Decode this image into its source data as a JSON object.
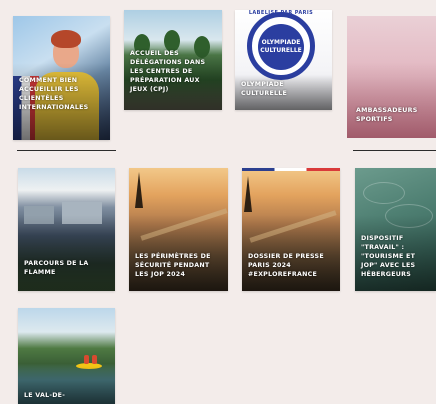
{
  "cards": [
    {
      "label": "COMMENT BIEN ACCUEILLIR LES CLIENTÈLES INTERNATIONALES"
    },
    {
      "label": "ACCUEIL DES DÉLÉGATIONS DANS LES CENTRES DE PRÉPARATION AUX JEUX (CPJ)"
    },
    {
      "label": "OLYMPIADE CULTURELLE",
      "logo_line1": "OLYMPIADE",
      "logo_line2": "CULTURELLE",
      "logo_ring": "LABELISÉ PAR PARIS 2024"
    },
    {
      "label": "AMBASSADEURS SPORTIFS"
    },
    {
      "label": "PARCOURS DE LA FLAMME"
    },
    {
      "label": "LES PÉRIMÈTRES DE SÉCURITÉ PENDANT LES JOP 2024"
    },
    {
      "label": "DOSSIER DE PRESSE PARIS 2024 #EXPLOREFRANCE"
    },
    {
      "label": "DISPOSITIF \"TRAVAIL\" : \"TOURISME ET JOP\" AVEC LES HÉBERGEURS"
    },
    {
      "label": "LE VAL-DE-"
    }
  ],
  "colors": {
    "background": "#f3ecea",
    "divider": "#2b2b2b",
    "logo_blue": "#2b3ea0"
  }
}
